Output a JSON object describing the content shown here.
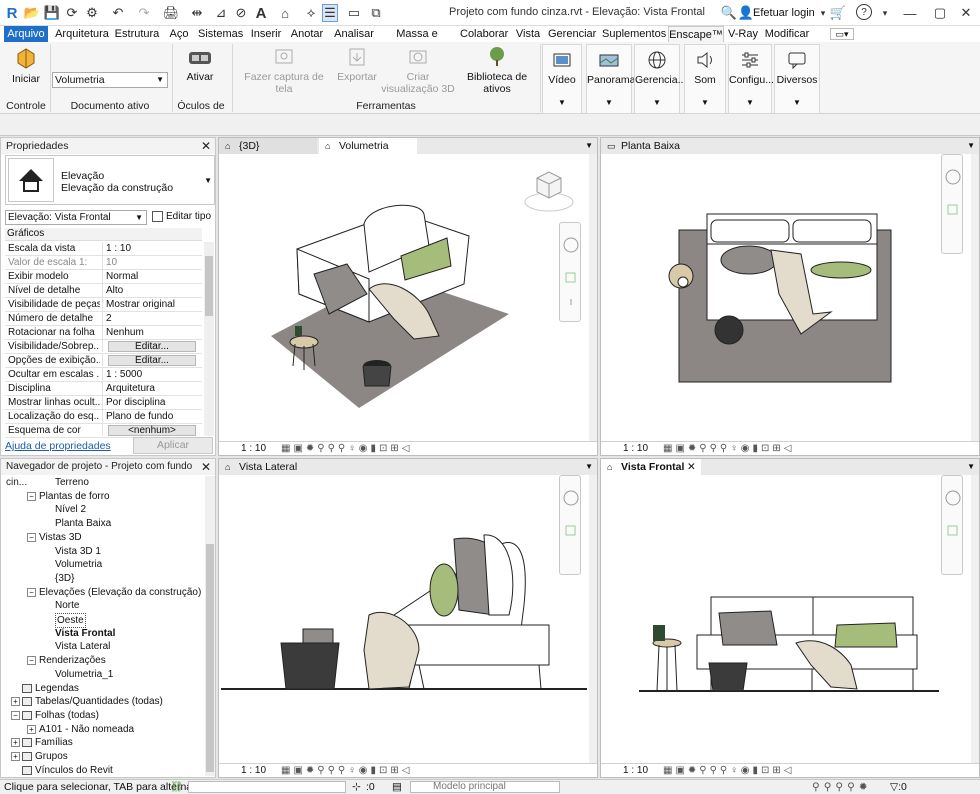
{
  "title": {
    "window_title": "Projeto com fundo cinza.rvt - Elevação: Vista Frontal",
    "login": "Efetuar login",
    "help": "?"
  },
  "ribbon_tabs": [
    "Arquivo",
    "Arquitetura",
    "Estrutura",
    "Aço",
    "Sistemas",
    "Inserir",
    "Anotar",
    "Analisar",
    "Massa e terreno",
    "Colaborar",
    "Vista",
    "Gerenciar",
    "Suplementos",
    "Enscape™",
    "V-Ray",
    "Modificar"
  ],
  "ribbon": {
    "iniciar": "Iniciar",
    "doc_select": "Volumetria",
    "ativar": "Ativar",
    "fazer_captura": "Fazer captura de tela",
    "exportar": "Exportar",
    "criar_visualizacao": "Criar visualização 3D",
    "biblioteca": "Biblioteca de ativos",
    "video": "Vídeo",
    "panorama": "Panorama",
    "gerencia": "Gerencia...",
    "som": "Som",
    "configu": "Configu...",
    "diversos": "Diversos",
    "groups": {
      "controle": "Controle",
      "documento": "Documento ativo",
      "oculos": "Óculos de RV",
      "ferramentas": "Ferramentas"
    }
  },
  "properties": {
    "title": "Propriedades",
    "type_name": "Elevação",
    "type_sub": "Elevação da construção",
    "selector": "Elevação: Vista Frontal",
    "edit_type": "Editar tipo",
    "section": "Gráficos",
    "rows": [
      {
        "k": "Escala da vista",
        "v": "1 : 10"
      },
      {
        "k": "Valor de escala    1:",
        "v": "10"
      },
      {
        "k": "Exibir modelo",
        "v": "Normal"
      },
      {
        "k": "Nível de detalhe",
        "v": "Alto"
      },
      {
        "k": "Visibilidade de peças",
        "v": "Mostrar original"
      },
      {
        "k": "Número de detalhe",
        "v": "2"
      },
      {
        "k": "Rotacionar na folha",
        "v": "Nenhum"
      },
      {
        "k": "Visibilidade/Sobrep...",
        "v": "Editar..."
      },
      {
        "k": "Opções de exibição...",
        "v": "Editar..."
      },
      {
        "k": "Ocultar em escalas ...",
        "v": "1 : 5000"
      },
      {
        "k": "Disciplina",
        "v": "Arquitetura"
      },
      {
        "k": "Mostrar linhas ocult...",
        "v": "Por disciplina"
      },
      {
        "k": "Localização do esq...",
        "v": "Plano de fundo"
      },
      {
        "k": "Esquema de cor",
        "v": "<nenhum>"
      }
    ],
    "help_link": "Ajuda de propriedades",
    "apply": "Aplicar"
  },
  "browser": {
    "title": "Navegador de projeto - Projeto com fundo cin...",
    "items": [
      {
        "t": "Terreno",
        "lvl": 3
      },
      {
        "t": "Plantas de forro",
        "lvl": 2,
        "tog": "−"
      },
      {
        "t": "Nível 2",
        "lvl": 3
      },
      {
        "t": "Planta Baixa",
        "lvl": 3
      },
      {
        "t": "Vistas 3D",
        "lvl": 2,
        "tog": "−"
      },
      {
        "t": "Vista 3D 1",
        "lvl": 3
      },
      {
        "t": "Volumetria",
        "lvl": 3
      },
      {
        "t": "{3D}",
        "lvl": 3
      },
      {
        "t": "Elevações (Elevação da construção)",
        "lvl": 2,
        "tog": "−"
      },
      {
        "t": "Norte",
        "lvl": 3
      },
      {
        "t": "Oeste",
        "lvl": 3
      },
      {
        "t": "Vista Frontal",
        "lvl": 3,
        "bold": true
      },
      {
        "t": "Vista Lateral",
        "lvl": 3
      },
      {
        "t": "Renderizações",
        "lvl": 2,
        "tog": "−"
      },
      {
        "t": "Volumetria_1",
        "lvl": 3
      },
      {
        "t": "Legendas",
        "lvl": 1,
        "ic": true
      },
      {
        "t": "Tabelas/Quantidades (todas)",
        "lvl": 1,
        "tog": "+",
        "ic": true
      },
      {
        "t": "Folhas (todas)",
        "lvl": 1,
        "tog": "−",
        "ic": true
      },
      {
        "t": "A101 - Não nomeada",
        "lvl": 2,
        "tog": "+"
      },
      {
        "t": "Famílias",
        "lvl": 1,
        "tog": "+",
        "ic": true
      },
      {
        "t": "Grupos",
        "lvl": 1,
        "tog": "+",
        "ic": true
      },
      {
        "t": "Vínculos do Revit",
        "lvl": 1,
        "ic": true
      }
    ]
  },
  "views": {
    "tab_3d": "{3D}",
    "tab_volumetria": "Volumetria",
    "tab_planta": "Planta Baixa",
    "tab_lateral": "Vista Lateral",
    "tab_frontal": "Vista Frontal",
    "scale": "1 : 10"
  },
  "status": {
    "hint": "Clique para selecionar, TAB para alternar",
    "count": ":0",
    "model": "Modelo principal"
  },
  "colors": {
    "accent": "#1e6fc9",
    "rug": "#8c8784",
    "pillow_green": "#a6bc7a",
    "pillow_gray": "#8f8c89"
  }
}
